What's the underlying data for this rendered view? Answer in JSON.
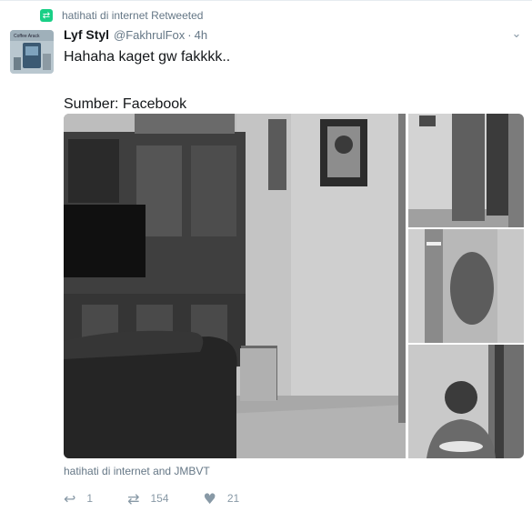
{
  "retweet": {
    "text": "hatihati di internet Retweeted",
    "icon": "retweet-icon"
  },
  "tweet": {
    "display_name": "Lyf Styl",
    "handle": "@FakhrulFox",
    "separator": "·",
    "time": "4h",
    "lines": [
      "Hahaha kaget gw fakkkk..",
      "Sumber: Facebook"
    ],
    "avatar_caption": "Coffee Arack"
  },
  "liked_by": "hatihati di internet and JMBVT",
  "actions": [
    {
      "name": "reply",
      "icon": "reply-icon",
      "count": "1"
    },
    {
      "name": "retweet",
      "icon": "retweet-icon",
      "count": "154"
    },
    {
      "name": "like",
      "icon": "heart-icon",
      "count": "21"
    }
  ],
  "colors": {
    "accent_green": "#19cf86",
    "muted": "#657786",
    "icon_gray": "#8899a6"
  }
}
